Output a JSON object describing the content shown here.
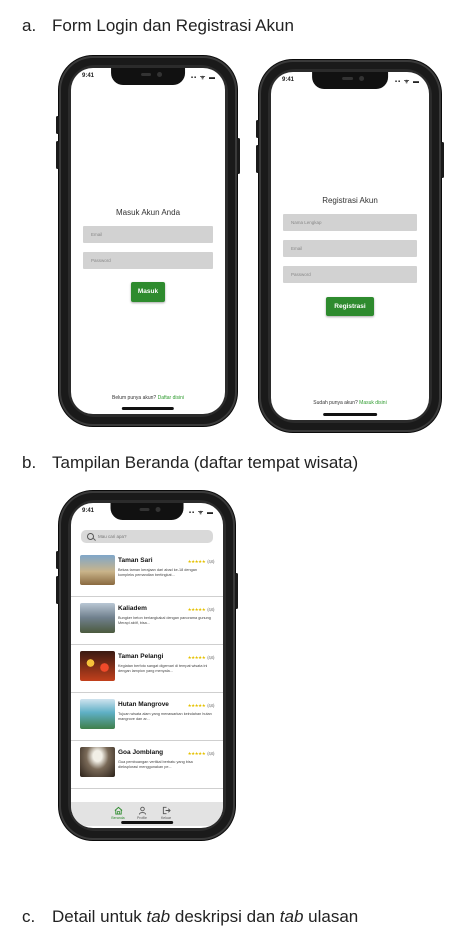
{
  "sections": {
    "a": {
      "letter": "a.",
      "title": "Form Login dan Registrasi Akun"
    },
    "b": {
      "letter": "b.",
      "title": "Tampilan Beranda (daftar tempat wisata)"
    },
    "c": {
      "letter": "c.",
      "pre": "Detail untuk ",
      "tab1": "tab",
      "mid": " deskripsi dan ",
      "tab2": "tab",
      "post": " ulasan"
    }
  },
  "status_time": "9:41",
  "login": {
    "title": "Masuk  Akun Anda",
    "email_placeholder": "Email",
    "password_placeholder": "Password",
    "button": "Masuk",
    "footer_text": "Belum punya akun? ",
    "footer_link": "Daftar disini"
  },
  "register": {
    "title": "Registrasi Akun",
    "name_placeholder": "Nama Lengkap",
    "email_placeholder": "Email",
    "password_placeholder": "Password",
    "button": "Registrasi",
    "footer_text": "Sudah punya akun? ",
    "footer_link": "Masuk disini"
  },
  "home": {
    "search_placeholder": "Mau cari apa?",
    "items": [
      {
        "name": "Taman Sari",
        "rating": "(4,6)",
        "desc": "Bekas taman kerajaan dari abad ke-18 dengan kompleks pemandian bertingkat...",
        "thumb_color": "#a08860"
      },
      {
        "name": "Kaliadem",
        "rating": "(4,6)",
        "desc": "Bungker beton berlangkakal dengan panorama gunung Merapi aktif, bisa...",
        "thumb_color": "#7f8f9c"
      },
      {
        "name": "Taman Pelangi",
        "rating": "(4,6)",
        "desc": "Kegiatan berfoto sangat digemari di tempat wisata ini dengan lampion yang menyala...",
        "thumb_color": "#b8451f"
      },
      {
        "name": "Hutan Mangrove",
        "rating": "(4,6)",
        "desc": "Tujuan wisata alam yang menawarkan keindahan hutan mangrove dan ar...",
        "thumb_color": "#4f9fb0"
      },
      {
        "name": "Goa Jomblang",
        "rating": "(4,6)",
        "desc": "Gua pembuangan vertikal berbatu yang bisa dieksplorasi menggunakan pe...",
        "thumb_color": "#5a4a3a"
      }
    ],
    "tabs": [
      {
        "label": "Beranda",
        "icon": "home-icon"
      },
      {
        "label": "Profile",
        "icon": "user-icon"
      },
      {
        "label": "Keluar",
        "icon": "logout-icon"
      }
    ]
  },
  "colors": {
    "accent": "#2e8b2e",
    "link": "#2e9b2e",
    "star": "#e5c100",
    "field": "#d2d2d2"
  }
}
